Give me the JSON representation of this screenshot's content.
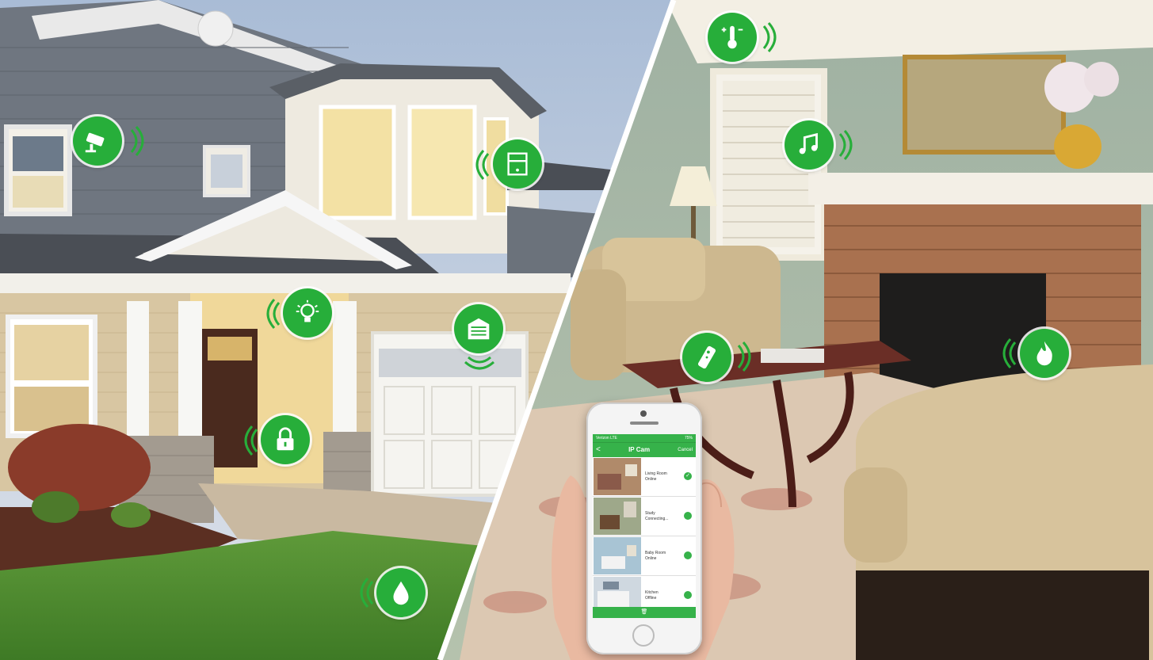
{
  "colors": {
    "accent": "#27ae3a",
    "accent_light": "#36b24a"
  },
  "hotspots": [
    {
      "name": "security-camera-icon"
    },
    {
      "name": "window-blinds-icon"
    },
    {
      "name": "light-bulb-icon"
    },
    {
      "name": "garage-door-icon"
    },
    {
      "name": "door-lock-icon"
    },
    {
      "name": "water-sprinkler-icon"
    },
    {
      "name": "thermostat-icon"
    },
    {
      "name": "music-note-icon"
    },
    {
      "name": "remote-control-icon"
    },
    {
      "name": "fireplace-flame-icon"
    }
  ],
  "phone_app": {
    "status": {
      "carrier": "Verizon LTE",
      "battery": "75%"
    },
    "nav": {
      "back": "<",
      "title": "IP Cam",
      "cancel": "Cancel"
    },
    "cameras": [
      {
        "name": "Living Room",
        "status": "Online"
      },
      {
        "name": "Study",
        "status": "Connecting..."
      },
      {
        "name": "Baby Room",
        "status": "Online"
      },
      {
        "name": "Kitchen",
        "status": "Offline"
      }
    ],
    "tab_icon": "trash-icon"
  }
}
